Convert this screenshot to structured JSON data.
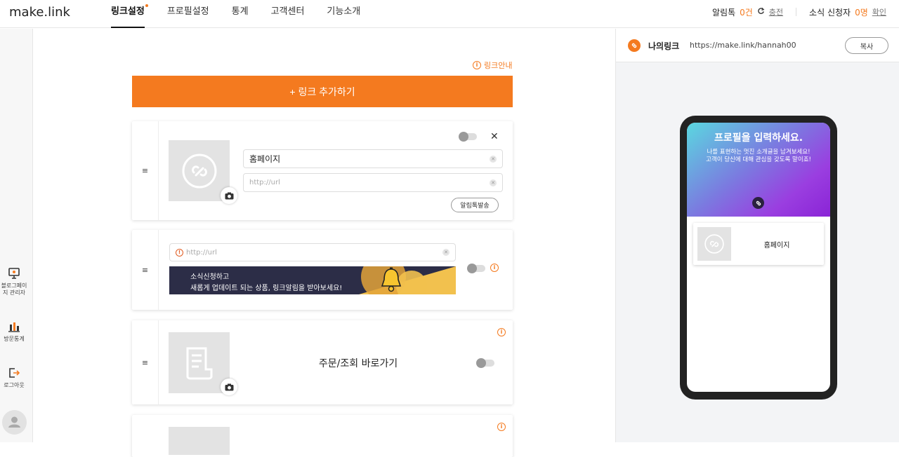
{
  "header": {
    "logo": "make.link",
    "nav": [
      {
        "label": "링크설정",
        "active": true
      },
      {
        "label": "프로필설정",
        "active": false
      },
      {
        "label": "통계",
        "active": false
      },
      {
        "label": "고객센터",
        "active": false
      },
      {
        "label": "기능소개",
        "active": false
      }
    ],
    "alimtalk_label": "알림톡",
    "alimtalk_count": "0건",
    "charge_label": "충전",
    "subscribers_label": "소식 신청자",
    "subscribers_count": "0명",
    "confirm_label": "확인"
  },
  "sidebar": {
    "items": [
      {
        "label": "블로그페이지 관리자",
        "icon": "monitor-icon"
      },
      {
        "label": "방문통계",
        "icon": "bar-chart-icon"
      },
      {
        "label": "로그아웃",
        "icon": "logout-icon"
      }
    ]
  },
  "main": {
    "guide_label": "링크안내",
    "add_button": "+ 링크 추가하기",
    "card1": {
      "title_value": "홈페이지",
      "url_placeholder": "http://url",
      "alimtalk_button": "알림톡발송"
    },
    "card2": {
      "url_placeholder": "http://url",
      "banner_line1": "소식신청하고",
      "banner_line2": "새롭게 업데이트 되는 상품, 링크알림을 받아보세요!"
    },
    "card3": {
      "title": "주문/조회 바로가기"
    }
  },
  "preview": {
    "mylink_label": "나의링크",
    "mylink_url": "https://make.link/hannah00",
    "copy_button": "복사",
    "hero_title": "프로필을 입력하세요.",
    "hero_line1": "나를 표현하는 멋진 소개글을 남겨보세요!",
    "hero_line2": "고객이 당신에 대해 관심을 갖도록 말이죠!",
    "card_title": "홈페이지"
  },
  "colors": {
    "accent": "#f47a1f",
    "banner_bg": "#2c2d47",
    "banner_yellow": "#f2c14e"
  }
}
